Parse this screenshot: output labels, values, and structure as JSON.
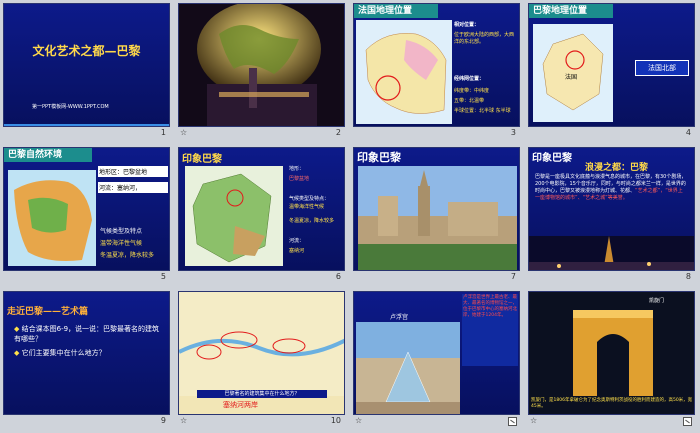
{
  "slides": [
    {
      "title": "文化艺术之都—巴黎",
      "footer": "第一PPT模板网-WWW.1PPT.COM",
      "num": "1"
    },
    {
      "star": "☆",
      "num": "2"
    },
    {
      "title": "法国地理位置",
      "label1": "相对位置：",
      "text1": "位于欧洲大陆的西部，大西洋的东北部。",
      "label2": "经纬网位置：",
      "text2a": "纬度带：中纬度",
      "text2b": "五带：北温带",
      "text2c": "半球位置：北半球 东半球",
      "num": "3"
    },
    {
      "title": "巴黎地理位置",
      "label": "法国北部",
      "map_label": "法国",
      "num": "4"
    },
    {
      "title": "巴黎自然环境",
      "terrain": "地形区：巴黎盆地",
      "river": "河流：塞纳河，",
      "climate_head": "气候类型及特点",
      "climate": "温带海洋性气候",
      "winter": "冬温夏凉，降水较多",
      "num": "5"
    },
    {
      "title": "印象巴黎",
      "t1": "地形：",
      "t2": "巴黎盆地",
      "t3": "气候类型及特点：",
      "t4": "温带海洋性气候",
      "t5": "冬温夏凉，降水较多",
      "t6": "河流：",
      "t7": "塞纳河",
      "num": "6"
    },
    {
      "title": "印象巴黎",
      "num": "7"
    },
    {
      "title": "印象巴黎",
      "subtitle": "浪漫之都：巴黎",
      "body": "巴黎是一座极具文化底蕴与浪漫气息的城市，在巴黎，有30个剧场，200个电影院，15个音乐厅，同时，与时尚之都米兰一样，是世界的时尚中心，巴黎又被浪漫地称为灯城、花都、",
      "highlight": "“艺术之都”，“世界上一座博物馆的城市”、“艺术之城”等美誉。",
      "num": "8"
    },
    {
      "title": "走近巴黎——艺术篇",
      "q1": "结合课本图6-9，说一说：巴黎最著名的建筑有哪些？",
      "q2": "它们主要集中在什么地方？",
      "num": "9"
    },
    {
      "caption": "塞纳河两岸",
      "map_q": "巴黎著名的建筑集中在什么地方？",
      "num": "10"
    },
    {
      "label": "卢浮宫",
      "box": "卢浮宫是世界上最古老、最大、最著名的博物馆之一，位于巴黎市中心的塞纳河北岸，始建于1204年。",
      "num": "11"
    },
    {
      "label": "凯旋门",
      "caption": "凯旋门，是1806年拿破仑为了纪念奥斯特利茨战役的胜利而建造的，高50米，宽45米。",
      "num": "12"
    }
  ],
  "star_symbol": "☆"
}
